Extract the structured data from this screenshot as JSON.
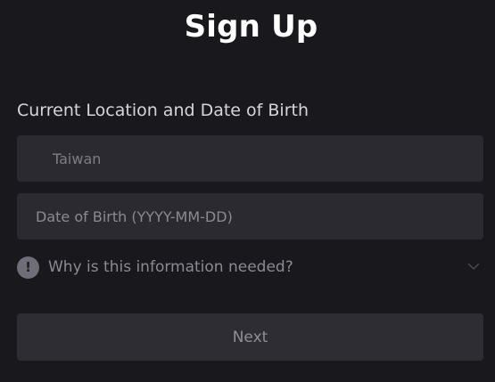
{
  "header": {
    "title": "Sign Up"
  },
  "form": {
    "section_label": "Current Location and Date of Birth",
    "country_value": "Taiwan",
    "dob_placeholder": "Date of Birth (YYYY-MM-DD)",
    "info_icon_glyph": "!",
    "info_text": "Why is this information needed?",
    "next_label": "Next"
  },
  "icons": {
    "info": "exclamation-circle-icon",
    "expand": "chevron-down-icon"
  },
  "colors": {
    "background": "#19181c",
    "field_background": "#2a2a30",
    "button_background": "#2e2d33",
    "title": "#ffffff",
    "muted_text": "#8b8a93"
  }
}
